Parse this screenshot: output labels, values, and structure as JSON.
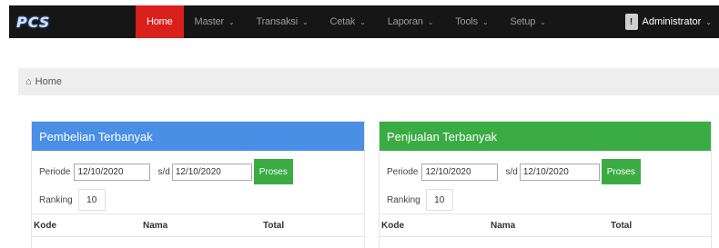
{
  "navbar": {
    "logo": "PCS",
    "items": [
      {
        "label": "Home",
        "active": true,
        "caret": false
      },
      {
        "label": "Master",
        "active": false,
        "caret": true
      },
      {
        "label": "Transaksi",
        "active": false,
        "caret": true
      },
      {
        "label": "Cetak",
        "active": false,
        "caret": true
      },
      {
        "label": "Laporan",
        "active": false,
        "caret": true
      },
      {
        "label": "Tools",
        "active": false,
        "caret": true
      },
      {
        "label": "Setup",
        "active": false,
        "caret": true
      }
    ],
    "user": "Administrator",
    "caret_glyph": "⌄"
  },
  "breadcrumb": {
    "label": "Home"
  },
  "panels": {
    "left": {
      "title": "Pembelian Terbanyak",
      "periode_label": "Periode",
      "date_from": "12/10/2020",
      "sd_label": "s/d",
      "date_to": "12/10/2020",
      "button": "Proses",
      "ranking_label": "Ranking",
      "ranking_value": "10",
      "columns": [
        "Kode",
        "Nama",
        "Total"
      ]
    },
    "right": {
      "title": "Penjualan Terbanyak",
      "periode_label": "Periode",
      "date_from": "12/10/2020",
      "sd_label": "s/d",
      "date_to": "12/10/2020",
      "button": "Proses",
      "ranking_label": "Ranking",
      "ranking_value": "10",
      "columns": [
        "Kode",
        "Nama",
        "Total"
      ]
    }
  },
  "colors": {
    "navbar_bg": "#161616",
    "active_tab": "#d9201d",
    "left_panel_header": "#4a8fe6",
    "right_panel_header": "#3aac43",
    "button": "#3aac43"
  }
}
